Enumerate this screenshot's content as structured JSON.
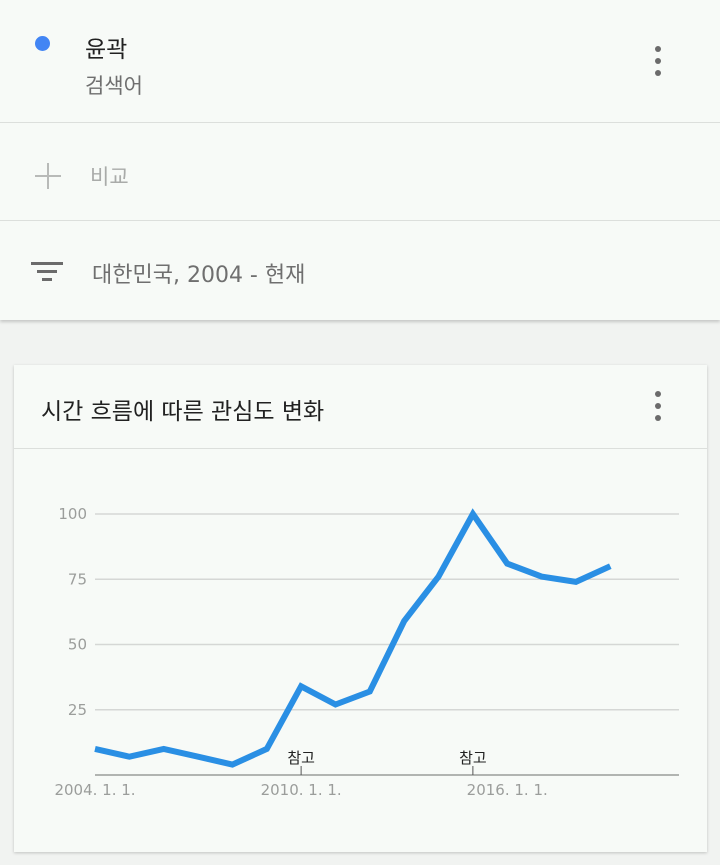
{
  "term": {
    "name": "윤곽",
    "type": "검색어",
    "dot_color": "#4285f4",
    "menu_icon": "more-vert-icon"
  },
  "compare": {
    "label": "비교",
    "icon": "plus-icon"
  },
  "filter": {
    "label": "대한민국, 2004 - 현재",
    "icon": "filter-list-icon"
  },
  "chart_card": {
    "title": "시간 흐름에 따른 관심도 변화",
    "menu_icon": "more-vert-icon"
  },
  "chart_data": {
    "type": "line",
    "title": "",
    "xlabel": "",
    "ylabel": "",
    "ylim": [
      0,
      100
    ],
    "y_ticks": [
      25,
      50,
      75,
      100
    ],
    "y_tick_labels": [
      "25",
      "50",
      "75",
      "100"
    ],
    "xlim": [
      2004.0,
      2021.0
    ],
    "x_ticks": [
      2004.0,
      2010.0,
      2016.0
    ],
    "x_tick_labels": [
      "2004. 1. 1.",
      "2010. 1. 1.",
      "2016. 1. 1."
    ],
    "grid": true,
    "line_color": "#2a8fe4",
    "series": [
      {
        "x": [
          2004.0,
          2005.0,
          2006.0,
          2007.0,
          2008.0,
          2009.0,
          2010.0,
          2011.0,
          2012.0,
          2013.0,
          2014.0,
          2015.0,
          2016.0,
          2017.0,
          2018.0,
          2019.0
        ],
        "values": [
          10,
          7,
          10,
          7,
          4,
          10,
          34,
          27,
          32,
          59,
          76,
          100,
          81,
          76,
          74,
          80
        ]
      }
    ],
    "annotations": [
      {
        "x": 2010.0,
        "label": "참고"
      },
      {
        "x": 2015.0,
        "label": "참고"
      }
    ]
  }
}
